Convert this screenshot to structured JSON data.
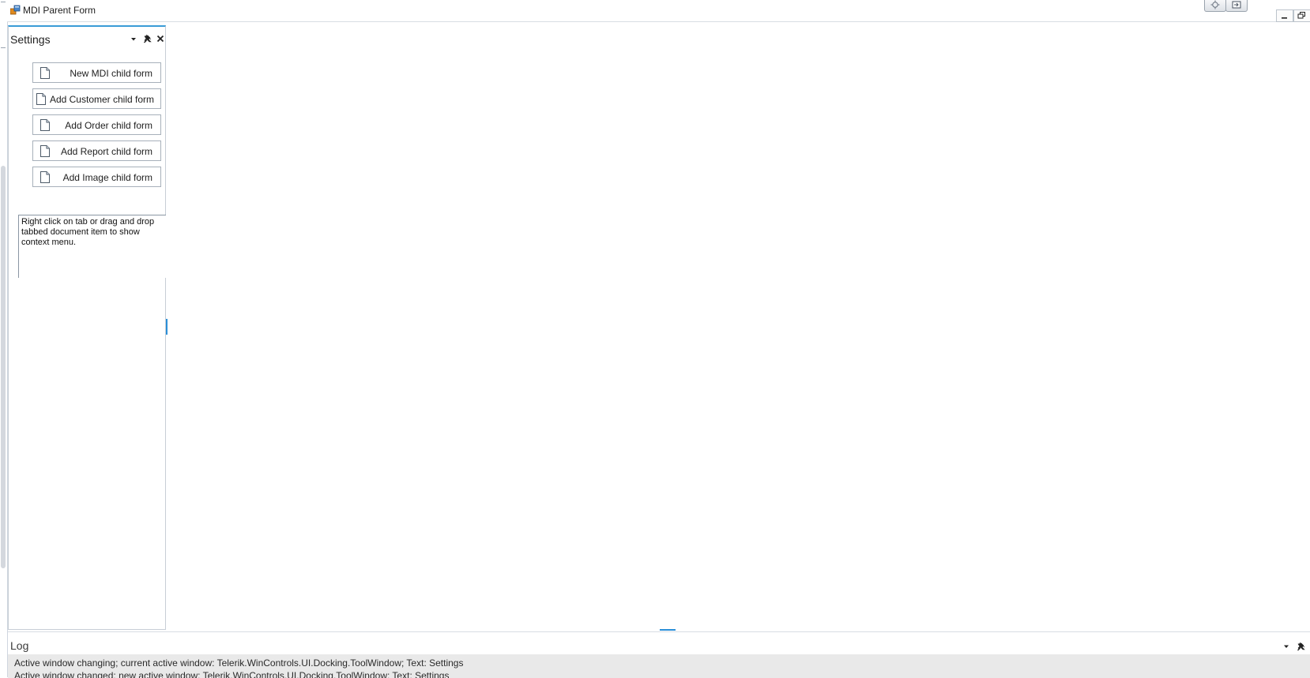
{
  "window": {
    "title": "MDI Parent Form"
  },
  "settings_panel": {
    "title": "Settings",
    "buttons": [
      {
        "label": "New MDI child form"
      },
      {
        "label": "Add Customer child form"
      },
      {
        "label": "Add Order child form"
      },
      {
        "label": "Add Report child form"
      },
      {
        "label": "Add Image child form"
      }
    ],
    "note": "Right click on tab or drag and drop tabbed document item to show context menu."
  },
  "log_panel": {
    "title": "Log",
    "lines": [
      "Active window changing; current active window: Telerik.WinControls.UI.Docking.ToolWindow; Text: Settings",
      "Active window changed; new active window: Telerik.WinControls.UI.Docking.ToolWindow; Text: Settings"
    ]
  },
  "icons": {
    "app": "app-icon",
    "panel_menu": "chevron-down-icon",
    "pin": "pin-icon",
    "close": "close-icon",
    "document": "document-icon"
  },
  "colors": {
    "accent": "#3a9bd6",
    "log_background": "#e9e9e9",
    "border": "#c7ced6"
  }
}
